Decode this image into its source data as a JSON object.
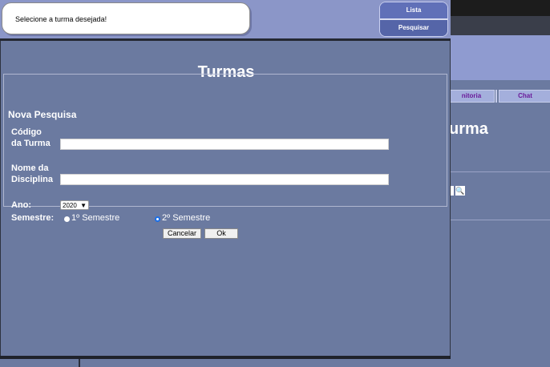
{
  "background_app": {
    "tab_monitoria": "nitoria",
    "tab_chat": "Chat",
    "title_fragment": "urma",
    "search_icon": "magnifier-icon"
  },
  "header": {
    "message": "Selecione a turma desejada!",
    "btn_lista": "Lista",
    "btn_pesquisar": "Pesquisar"
  },
  "panel": {
    "title": "Turmas",
    "legend": "Nova Pesquisa",
    "codigo_label_1": "Código",
    "codigo_label_2": "da Turma",
    "codigo_value": "",
    "nome_label_1": "Nome da",
    "nome_label_2": "Disciplina",
    "nome_value": "",
    "ano_label": "Ano:",
    "ano_value": "2020",
    "semestre_label": "Semestre:",
    "semestre_1": "1º Semestre",
    "semestre_2": "2º Semestre",
    "semestre_selected": "2º Semestre",
    "cancel_label": "Cancelar",
    "ok_label": "Ok"
  },
  "colors": {
    "panel_bg": "#6b7aa0",
    "header_bg": "#8b96c8",
    "radio_selected": "#1a6fe8"
  }
}
